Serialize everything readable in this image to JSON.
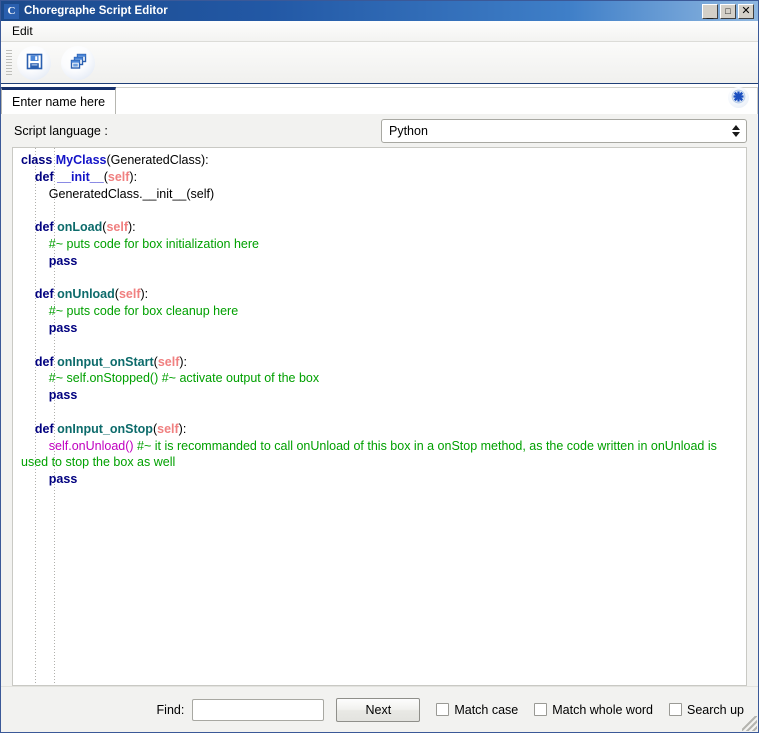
{
  "window": {
    "title": "Choregraphe Script Editor",
    "app_icon_letter": "C",
    "controls": {
      "minimize": "_",
      "maximize": "□",
      "close": "✕"
    }
  },
  "menubar": {
    "items": [
      {
        "label": "Edit"
      }
    ]
  },
  "toolbar": {
    "buttons": [
      {
        "name": "save-script-button",
        "icon": "save-icon"
      },
      {
        "name": "duplicate-window-button",
        "icon": "stacked-windows-icon"
      }
    ]
  },
  "tabs": {
    "items": [
      {
        "label": "Enter name here",
        "active": true
      }
    ],
    "close_icon": "close-tab-icon"
  },
  "language": {
    "label": "Script language :",
    "selected": "Python",
    "options": [
      "Python"
    ]
  },
  "editor": {
    "lines": [
      [
        {
          "t": "class ",
          "c": "kw"
        },
        {
          "t": "MyClass",
          "c": "cls"
        },
        {
          "t": "(GeneratedClass):",
          "c": "plain"
        }
      ],
      [
        {
          "t": "    ",
          "c": "plain"
        },
        {
          "t": "def ",
          "c": "kw"
        },
        {
          "t": "__init__",
          "c": "cls"
        },
        {
          "t": "(",
          "c": "plain"
        },
        {
          "t": "self",
          "c": "selfarg"
        },
        {
          "t": "):",
          "c": "plain"
        }
      ],
      [
        {
          "t": "        GeneratedClass.__init__(self)",
          "c": "plain"
        }
      ],
      [],
      [
        {
          "t": "    ",
          "c": "plain"
        },
        {
          "t": "def ",
          "c": "kw"
        },
        {
          "t": "onLoad",
          "c": "fn"
        },
        {
          "t": "(",
          "c": "plain"
        },
        {
          "t": "self",
          "c": "selfarg"
        },
        {
          "t": "):",
          "c": "plain"
        }
      ],
      [
        {
          "t": "        ",
          "c": "plain"
        },
        {
          "t": "#~ puts code for box initialization here",
          "c": "cmt"
        }
      ],
      [
        {
          "t": "        ",
          "c": "plain"
        },
        {
          "t": "pass",
          "c": "kw"
        }
      ],
      [],
      [
        {
          "t": "    ",
          "c": "plain"
        },
        {
          "t": "def ",
          "c": "kw"
        },
        {
          "t": "onUnload",
          "c": "fn"
        },
        {
          "t": "(",
          "c": "plain"
        },
        {
          "t": "self",
          "c": "selfarg"
        },
        {
          "t": "):",
          "c": "plain"
        }
      ],
      [
        {
          "t": "        ",
          "c": "plain"
        },
        {
          "t": "#~ puts code for box cleanup here",
          "c": "cmt"
        }
      ],
      [
        {
          "t": "        ",
          "c": "plain"
        },
        {
          "t": "pass",
          "c": "kw"
        }
      ],
      [],
      [
        {
          "t": "    ",
          "c": "plain"
        },
        {
          "t": "def ",
          "c": "kw"
        },
        {
          "t": "onInput_onStart",
          "c": "fn"
        },
        {
          "t": "(",
          "c": "plain"
        },
        {
          "t": "self",
          "c": "selfarg"
        },
        {
          "t": "):",
          "c": "plain"
        }
      ],
      [
        {
          "t": "        ",
          "c": "plain"
        },
        {
          "t": "#~ self.onStopped() #~ activate output of the box",
          "c": "cmt"
        }
      ],
      [
        {
          "t": "        ",
          "c": "plain"
        },
        {
          "t": "pass",
          "c": "kw"
        }
      ],
      [],
      [
        {
          "t": "    ",
          "c": "plain"
        },
        {
          "t": "def ",
          "c": "kw"
        },
        {
          "t": "onInput_onStop",
          "c": "fn"
        },
        {
          "t": "(",
          "c": "plain"
        },
        {
          "t": "self",
          "c": "selfarg"
        },
        {
          "t": "):",
          "c": "plain"
        }
      ],
      [
        {
          "t": "        ",
          "c": "plain"
        },
        {
          "t": "self.onUnload()",
          "c": "call"
        },
        {
          "t": " #~ it is recommanded to call onUnload of this box in a onStop method, as the code written in onUnload is used to stop the box as well",
          "c": "cmt"
        }
      ],
      [
        {
          "t": "        ",
          "c": "plain"
        },
        {
          "t": "pass",
          "c": "kw"
        }
      ]
    ]
  },
  "findbar": {
    "find_label": "Find:",
    "find_value": "",
    "find_placeholder": "",
    "next_label": "Next",
    "checkboxes": [
      {
        "label": "Match case",
        "checked": false
      },
      {
        "label": "Match whole word",
        "checked": false
      },
      {
        "label": "Search up",
        "checked": false
      }
    ]
  },
  "colors": {
    "titlebar_start": "#1c4a8c",
    "tab_accent": "#16306b",
    "keyword": "#00007f",
    "class_name": "#1414c8",
    "function_name": "#0d6b6b",
    "self_arg": "#f08080",
    "comment": "#00a000",
    "call": "#c000c0"
  }
}
